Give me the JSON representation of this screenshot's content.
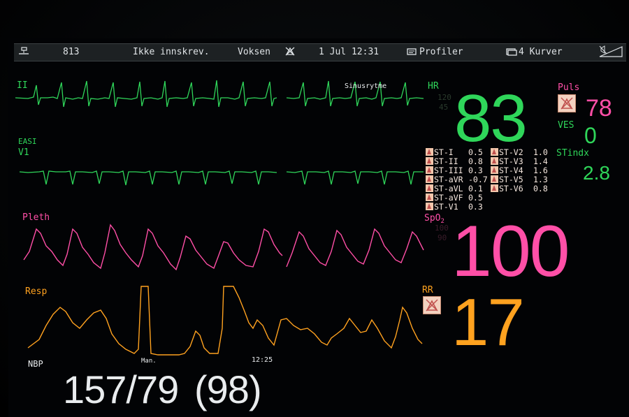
{
  "topbar": {
    "bed": "813",
    "status": "Ikke innskrev.",
    "patient_type": "Voksen",
    "date_time": "1 Jul 12:31",
    "profiles": "Profiler",
    "curves": "4 Kurver"
  },
  "waves": {
    "ecg_lead": "II",
    "rhythm": "Sinusrytme",
    "ecg2_group": "EASI",
    "ecg2_lead": "V1",
    "pleth": "Pleth",
    "resp": "Resp",
    "resp_man": "Man.",
    "resp_time": "12:25"
  },
  "hr": {
    "label": "HR",
    "high": "120",
    "low": "45",
    "value": "83"
  },
  "pulse": {
    "label": "Puls",
    "value": "78"
  },
  "ves": {
    "label": "VES",
    "value": "0"
  },
  "stindx": {
    "label": "STindx",
    "value": "2.8"
  },
  "st_left": [
    {
      "lead": "ST-I",
      "value": "0.5"
    },
    {
      "lead": "ST-II",
      "value": "0.8"
    },
    {
      "lead": "ST-III",
      "value": "0.3"
    },
    {
      "lead": "ST-aVR",
      "value": "-0.7"
    },
    {
      "lead": "ST-aVL",
      "value": "0.1"
    },
    {
      "lead": "ST-aVF",
      "value": "0.5"
    },
    {
      "lead": "ST-V1",
      "value": "0.3"
    }
  ],
  "st_right": [
    {
      "lead": "ST-V2",
      "value": "1.0"
    },
    {
      "lead": "ST-V3",
      "value": "1.4"
    },
    {
      "lead": "ST-V4",
      "value": "1.6"
    },
    {
      "lead": "ST-V5",
      "value": "1.3"
    },
    {
      "lead": "ST-V6",
      "value": "0.8"
    }
  ],
  "spo2": {
    "label": "SpO",
    "sub": "2",
    "high": "100",
    "low": "90",
    "value": "100"
  },
  "rr": {
    "label": "RR",
    "value": "17"
  },
  "nbp": {
    "label": "NBP",
    "value": "157/79",
    "mean": "(98)"
  },
  "colors": {
    "ecg": "#2fd65a",
    "pleth": "#ff4fa7",
    "resp": "#ffa21f",
    "numbers": "#e9ecee"
  }
}
